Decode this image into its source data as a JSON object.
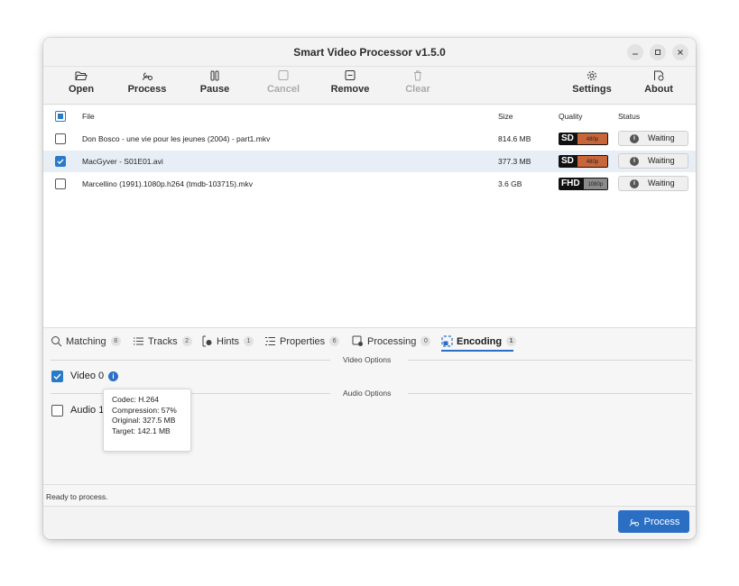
{
  "window": {
    "title": "Smart Video Processor v1.5.0",
    "controls": [
      "minimize-icon",
      "maximize-icon",
      "close-icon"
    ]
  },
  "toolbar": {
    "open": {
      "label": "Open",
      "icon": "folder-open-icon"
    },
    "process": {
      "label": "Process",
      "icon": "wrench-gear-icon"
    },
    "pause": {
      "label": "Pause",
      "icon": "pause-icon"
    },
    "cancel": {
      "label": "Cancel",
      "icon": "stop-square-icon",
      "enabled": false
    },
    "remove": {
      "label": "Remove",
      "icon": "minus-square-icon"
    },
    "clear": {
      "label": "Clear",
      "icon": "trash-icon",
      "enabled": false
    },
    "settings": {
      "label": "Settings",
      "icon": "gear-icon"
    },
    "about": {
      "label": "About",
      "icon": "about-icon"
    }
  },
  "file_list": {
    "columns": {
      "file": "File",
      "size": "Size",
      "quality": "Quality",
      "status": "Status"
    },
    "rows": [
      {
        "name": "Don Bosco - une vie pour les jeunes (2004) - part1.mkv",
        "size": "814.6 MB",
        "quality": "SD",
        "resolution": "480p",
        "status": "Waiting",
        "checked": false,
        "selected": false
      },
      {
        "name": "MacGyver - S01E01.avi",
        "size": "377.3 MB",
        "quality": "SD",
        "resolution": "480p",
        "status": "Waiting",
        "checked": true,
        "selected": true
      },
      {
        "name": "Marcellino (1991).1080p.h264 (tmdb-103715).mkv",
        "size": "3.6 GB",
        "quality": "FHD",
        "resolution": "1080p",
        "status": "Waiting",
        "checked": false,
        "selected": false
      }
    ]
  },
  "tabs": [
    {
      "label": "Matching",
      "count": "8",
      "icon": "search-icon"
    },
    {
      "label": "Tracks",
      "count": "2",
      "icon": "list-icon"
    },
    {
      "label": "Hints",
      "count": "1",
      "icon": "hint-icon"
    },
    {
      "label": "Properties",
      "count": "6",
      "icon": "properties-icon"
    },
    {
      "label": "Processing",
      "count": "0",
      "icon": "processing-icon"
    },
    {
      "label": "Encoding",
      "count": "1",
      "icon": "encoding-icon",
      "active": true
    }
  ],
  "encoding": {
    "video_section": "Video Options",
    "video_track": {
      "label": "Video 0",
      "checked": true
    },
    "audio_section": "Audio Options",
    "audio_track": {
      "label": "Audio 1",
      "checked": false
    },
    "tooltip": {
      "codec": "Codec: H.264",
      "compression": "Compression: 57%",
      "original": "Original: 327.5 MB",
      "target": "Target: 142.1 MB"
    }
  },
  "status_text": "Ready to process.",
  "footer": {
    "process_label": "Process"
  },
  "colors": {
    "accent": "#2a6fc4",
    "checkbox": "#2a7ac8",
    "sd_bar": "#c8663a",
    "fhd_bar": "#8a8a8a"
  }
}
